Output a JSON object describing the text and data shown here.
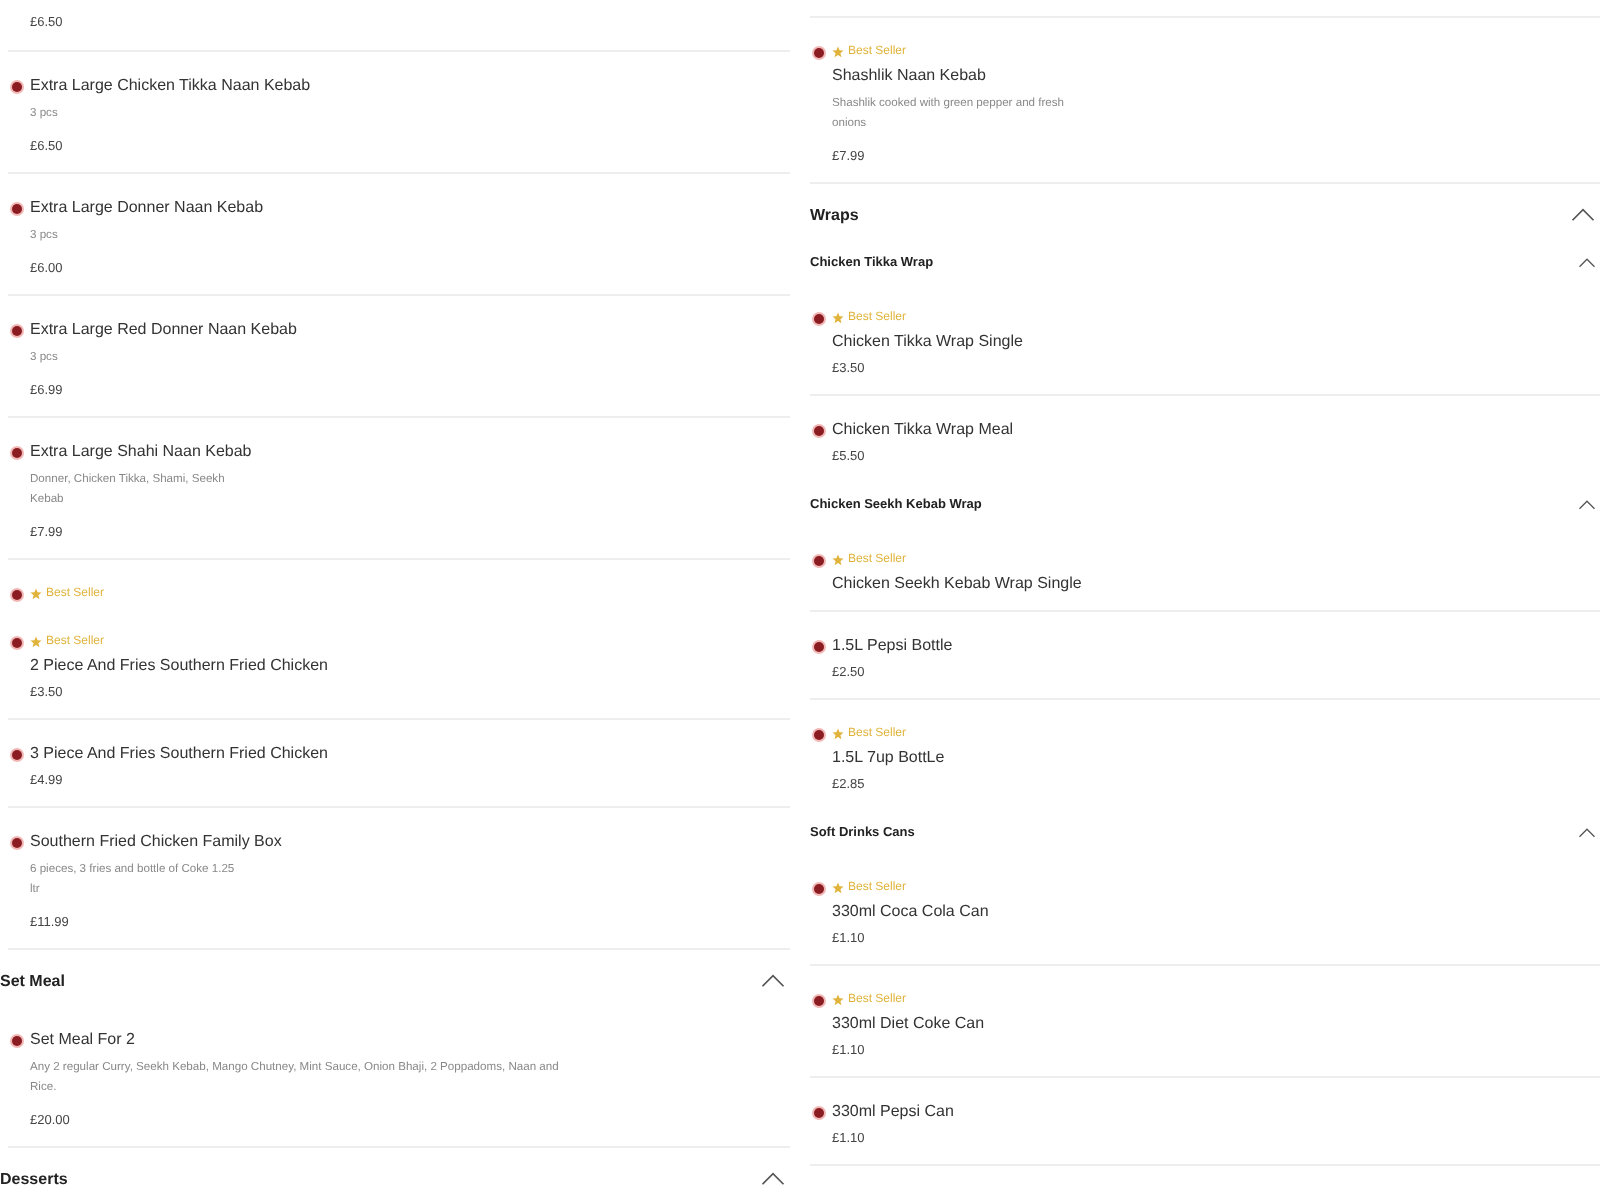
{
  "columns": [
    {
      "entries": [
        {
          "kind": "price",
          "price": "£6.50"
        },
        {
          "kind": "item",
          "name": "Extra Large Chicken Tikka Naan Kebab",
          "desc_lines": [
            "3 pcs"
          ],
          "price": "£6.50"
        },
        {
          "kind": "item",
          "name": "Extra Large Donner Naan Kebab",
          "desc_lines": [
            "3 pcs"
          ],
          "price": "£6.00"
        },
        {
          "kind": "item",
          "name": "Extra Large Red Donner Naan Kebab",
          "desc_lines": [
            "3 pcs"
          ],
          "price": "£6.99"
        },
        {
          "kind": "item",
          "name": "Extra Large Shahi Naan Kebab",
          "desc_lines": [
            "Donner, Chicken Tikka, Shami, Seekh",
            "Kebab"
          ],
          "price": "£7.99"
        },
        {
          "kind": "clipped",
          "badge": "Best Seller"
        },
        {
          "kind": "item",
          "badge": "Best Seller",
          "name": "2 Piece And Fries Southern Fried Chicken",
          "price": "£3.50"
        },
        {
          "kind": "item",
          "name": "3 Piece And Fries Southern Fried Chicken",
          "price": "£4.99"
        },
        {
          "kind": "item",
          "name": "Southern Fried Chicken Family Box",
          "desc_lines": [
            "6 pieces, 3 fries and bottle of Coke 1.25",
            "ltr"
          ],
          "price": "£11.99"
        },
        {
          "kind": "section",
          "title": "Set Meal",
          "expanded": true
        },
        {
          "kind": "item",
          "name": "Set Meal For 2",
          "desc_lines": [
            "Any 2 regular Curry, Seekh Kebab, Mango Chutney, Mint Sauce, Onion Bhaji, 2 Poppadoms, Naan and",
            "Rice."
          ],
          "price": "£20.00"
        },
        {
          "kind": "section",
          "title": "Desserts",
          "expanded": true
        }
      ]
    },
    {
      "entries": [
        {
          "kind": "item",
          "badge": "Best Seller",
          "name": "Shashlik Naan Kebab",
          "desc_lines": [
            "Shashlik cooked with green pepper and fresh",
            "onions"
          ],
          "price": "£7.99"
        },
        {
          "kind": "section",
          "title": "Wraps",
          "expanded": true
        },
        {
          "kind": "subsection",
          "title": "Chicken Tikka Wrap",
          "expanded": true
        },
        {
          "kind": "item",
          "badge": "Best Seller",
          "name": "Chicken Tikka Wrap Single",
          "price": "£3.50"
        },
        {
          "kind": "item",
          "name": "Chicken Tikka Wrap Meal",
          "price": "£5.50"
        },
        {
          "kind": "subsection",
          "title": "Chicken Seekh Kebab Wrap",
          "expanded": true
        },
        {
          "kind": "item",
          "badge": "Best Seller",
          "name": "Chicken Seekh Kebab Wrap Single"
        },
        {
          "kind": "item",
          "name": "1.5L Pepsi Bottle",
          "price": "£2.50"
        },
        {
          "kind": "item",
          "badge": "Best Seller",
          "name": "1.5L 7up BottLe",
          "price": "£2.85"
        },
        {
          "kind": "subsection",
          "title": "Soft Drinks Cans",
          "expanded": true
        },
        {
          "kind": "item",
          "badge": "Best Seller",
          "name": "330ml Coca Cola Can",
          "price": "£1.10"
        },
        {
          "kind": "item",
          "badge": "Best Seller",
          "name": "330ml Diet Coke Can",
          "price": "£1.10"
        },
        {
          "kind": "item",
          "name": "330ml Pepsi Can",
          "price": "£1.10"
        }
      ]
    }
  ]
}
